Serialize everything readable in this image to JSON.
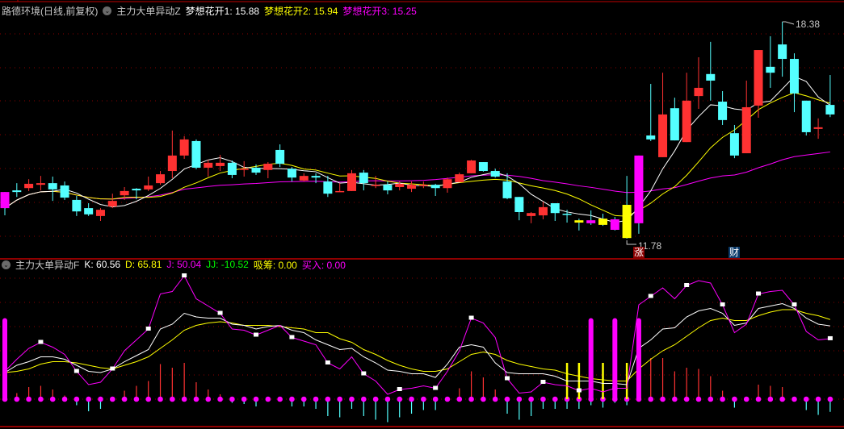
{
  "price_header": {
    "title": "路德环境(日线,前复权)",
    "indicator": "主力大单异动Z",
    "ma1": "梦想花开1: 15.88",
    "ma2": "梦想花开2: 15.94",
    "ma3": "梦想花开3: 15.25"
  },
  "indicator_header": {
    "name": "主力大单异动F",
    "k": "K: 60.56",
    "d": "D: 65.81",
    "j": "J: 50.04",
    "jj": "JJ: -10.52",
    "xichou": "吸筹: 0.00",
    "mairu": "买入: 0.00"
  },
  "annotations": {
    "high_label": "18.38",
    "low_label": "11.78",
    "badge_zhang": "涨",
    "badge_cai": "财"
  },
  "colors": {
    "up": "#ff3232",
    "down": "#54ffff",
    "ma1": "#ffffff",
    "ma2": "#ffff00",
    "ma3": "#ff00ff",
    "grid": "#8b0000",
    "divider": "#c00000"
  },
  "chart_data": [
    {
      "type": "candlestick",
      "title": "路德环境(日线,前复权)",
      "fields": [
        "open",
        "high",
        "low",
        "close",
        "highlight"
      ],
      "high_mark": 18.38,
      "low_mark": 11.78,
      "ma_periods": [
        5,
        10,
        30
      ],
      "candles": [
        [
          13.2,
          13.2,
          12.49,
          12.71,
          "magenta"
        ],
        [
          13.25,
          13.47,
          13.05,
          13.2
        ],
        [
          13.32,
          13.59,
          13.23,
          13.45
        ],
        [
          13.42,
          13.69,
          13.25,
          13.47
        ],
        [
          13.47,
          13.67,
          12.93,
          13.28
        ],
        [
          13.4,
          13.52,
          12.96,
          13.03
        ],
        [
          12.96,
          13.08,
          12.47,
          12.61
        ],
        [
          12.71,
          12.86,
          12.47,
          12.52
        ],
        [
          12.47,
          12.71,
          12.32,
          12.66
        ],
        [
          12.76,
          13.15,
          12.71,
          12.93
        ],
        [
          13.1,
          13.35,
          12.96,
          13.23
        ],
        [
          13.3,
          13.32,
          12.98,
          13.25
        ],
        [
          13.28,
          13.67,
          13.23,
          13.4
        ],
        [
          13.47,
          13.84,
          13.42,
          13.74
        ],
        [
          13.84,
          15.07,
          13.62,
          14.31
        ],
        [
          14.31,
          14.9,
          14.21,
          14.8
        ],
        [
          14.75,
          14.8,
          13.89,
          13.94
        ],
        [
          13.94,
          14.18,
          13.67,
          14.09
        ],
        [
          13.99,
          14.33,
          13.84,
          14.09
        ],
        [
          14.09,
          14.16,
          13.62,
          13.72
        ],
        [
          13.89,
          14.14,
          13.67,
          13.91
        ],
        [
          13.94,
          14.04,
          13.72,
          13.79
        ],
        [
          13.87,
          14.11,
          13.62,
          14.06
        ],
        [
          14.48,
          14.65,
          13.96,
          14.06
        ],
        [
          13.91,
          13.96,
          13.52,
          13.64
        ],
        [
          13.55,
          13.77,
          13.52,
          13.69
        ],
        [
          13.69,
          13.77,
          13.47,
          13.64
        ],
        [
          13.52,
          13.69,
          13.05,
          13.15
        ],
        [
          13.2,
          13.47,
          13.2,
          13.23
        ],
        [
          13.23,
          13.87,
          13.23,
          13.77
        ],
        [
          13.79,
          13.87,
          13.25,
          13.47
        ],
        [
          13.4,
          13.69,
          13.32,
          13.42
        ],
        [
          13.42,
          13.52,
          13.13,
          13.25
        ],
        [
          13.35,
          13.52,
          13.25,
          13.45
        ],
        [
          13.3,
          13.52,
          13.2,
          13.42
        ],
        [
          13.4,
          13.52,
          13.32,
          13.42
        ],
        [
          13.42,
          13.45,
          13.08,
          13.32
        ],
        [
          13.32,
          13.64,
          13.18,
          13.59
        ],
        [
          13.5,
          13.79,
          13.5,
          13.74
        ],
        [
          13.77,
          14.18,
          13.77,
          14.16
        ],
        [
          14.11,
          14.11,
          13.82,
          13.84
        ],
        [
          13.84,
          13.91,
          13.64,
          13.67
        ],
        [
          13.52,
          13.77,
          12.98,
          13.01
        ],
        [
          13.05,
          13.05,
          12.34,
          12.59
        ],
        [
          12.47,
          12.59,
          12.25,
          12.56
        ],
        [
          12.49,
          12.91,
          12.37,
          12.74
        ],
        [
          12.86,
          12.86,
          12.32,
          12.56
        ],
        [
          12.54,
          12.66,
          12.27,
          12.52
        ],
        [
          12.34,
          12.39,
          12.03,
          12.27,
          "yellow"
        ],
        [
          12.25,
          12.64,
          12.2,
          12.34,
          "magenta"
        ],
        [
          12.39,
          12.54,
          12.17,
          12.2,
          "yellow"
        ],
        [
          12.37,
          12.44,
          12.03,
          12.05,
          "magenta"
        ],
        [
          11.8,
          13.69,
          11.78,
          12.81,
          "yellow"
        ],
        [
          12.25,
          14.31,
          11.93,
          14.31,
          "magenta"
        ],
        [
          14.92,
          16.49,
          14.75,
          14.8
        ],
        [
          14.26,
          16.83,
          14.26,
          15.56
        ],
        [
          15.75,
          16.07,
          14.77,
          14.77
        ],
        [
          14.72,
          16.83,
          14.72,
          15.98
        ],
        [
          16.12,
          17.3,
          15.73,
          16.37
        ],
        [
          16.79,
          17.77,
          15.98,
          16.59
        ],
        [
          15.95,
          16.27,
          15.24,
          15.39
        ],
        [
          14.99,
          15.24,
          14.23,
          14.31
        ],
        [
          14.38,
          16.59,
          14.38,
          15.78
        ],
        [
          15.83,
          17.52,
          15.46,
          17.52
        ],
        [
          17.01,
          17.94,
          16.37,
          16.83
        ],
        [
          17.69,
          18.38,
          16.71,
          17.25
        ],
        [
          17.25,
          17.42,
          15.63,
          16.2
        ],
        [
          15.98,
          15.98,
          14.92,
          15.02
        ],
        [
          15.12,
          15.44,
          14.82,
          15.17
        ],
        [
          15.85,
          16.76,
          15.48,
          15.56
        ]
      ]
    },
    {
      "type": "line+bar",
      "title": "主力大单异动F",
      "K": [
        22,
        28,
        31,
        35,
        35,
        33,
        28,
        23,
        22,
        25,
        31,
        36,
        41,
        58,
        62,
        71,
        68,
        67,
        67,
        62,
        61,
        58,
        60,
        61,
        57,
        55,
        49,
        45,
        41,
        42,
        35,
        30,
        24,
        23,
        21,
        21,
        18,
        29,
        43,
        45,
        43,
        30,
        22,
        21,
        21,
        21,
        19,
        15,
        15,
        15,
        13,
        13,
        12,
        42,
        49,
        58,
        59,
        68,
        73,
        75,
        71,
        61,
        63,
        75,
        77,
        79,
        75,
        67,
        62,
        60.56
      ],
      "D": [
        22,
        23,
        25,
        29,
        31,
        31,
        30,
        28,
        26,
        25,
        28,
        31,
        35,
        42,
        49,
        57,
        61,
        63,
        64,
        63,
        61,
        61,
        61,
        60,
        59,
        58,
        55,
        55,
        50,
        47,
        41,
        37,
        32,
        28,
        25,
        23,
        23,
        25,
        31,
        37,
        39,
        37,
        32,
        29,
        27,
        25,
        24,
        21,
        19,
        17,
        16,
        15,
        15,
        25,
        33,
        40,
        45,
        52,
        59,
        65,
        67,
        65,
        65,
        69,
        72,
        74,
        74,
        71,
        69,
        65.81
      ],
      "J": [
        23,
        33,
        42,
        47,
        43,
        37,
        23,
        12,
        14,
        25,
        40,
        49,
        58,
        87,
        89,
        102,
        83,
        77,
        71,
        58,
        57,
        53,
        57,
        61,
        51,
        48,
        45,
        30,
        25,
        35,
        21,
        15,
        4,
        8,
        9,
        11,
        9,
        23,
        40,
        67,
        63,
        51,
        17,
        5,
        6,
        14,
        12,
        11,
        7,
        9,
        6,
        9,
        9,
        78,
        85,
        92,
        83,
        94,
        98,
        96,
        78,
        55,
        62,
        87,
        89,
        90,
        78,
        56,
        49,
        50.04
      ],
      "JJ": [
        0,
        5,
        10,
        11,
        8,
        3,
        -5,
        -10,
        -8,
        0,
        7,
        11,
        15,
        29,
        26,
        30,
        14,
        8,
        4,
        -3,
        -4,
        -6,
        0,
        0,
        -6,
        -6,
        -8,
        -14,
        -15,
        -8,
        -14,
        -17,
        -19,
        -15,
        -12,
        -9,
        -9,
        0,
        9,
        23,
        18,
        8,
        -12,
        -17,
        -14,
        -8,
        -8,
        -8,
        -8,
        -5,
        -7,
        -3,
        -5,
        0,
        34,
        34,
        23,
        26,
        25,
        19,
        7,
        -7,
        0,
        12,
        11,
        10,
        0,
        -9,
        -13,
        -10.52
      ],
      "xichou_bars": {
        "47": 30,
        "48": 30,
        "50": 30,
        "52": 30
      },
      "mairu_bars": {
        "0": 67,
        "49": 67,
        "51": 67,
        "53": 67
      },
      "ylim": [
        -25,
        100
      ]
    }
  ]
}
